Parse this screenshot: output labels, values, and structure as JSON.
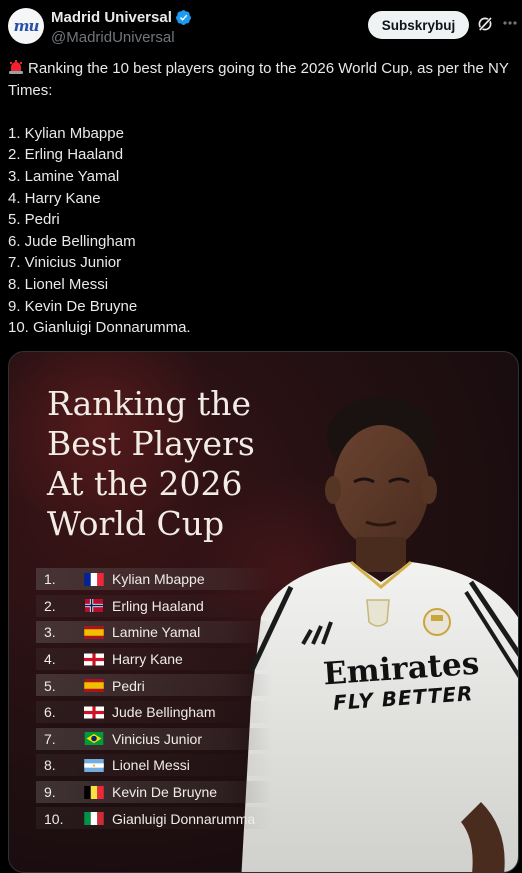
{
  "account": {
    "display_name": "Madrid Universal",
    "handle": "@MadridUniversal",
    "avatar_text": "mu"
  },
  "actions": {
    "subscribe_label": "Subskrybuj"
  },
  "tweet": {
    "text_intro": "Ranking the 10 best players going to the 2026 World Cup, as per the NY Times:",
    "list": [
      "1. Kylian Mbappe",
      "2. Erling Haaland",
      "3. Lamine Yamal",
      "4. Harry Kane",
      "5. Pedri",
      "6. Jude Bellingham",
      "7. Vinicius Junior",
      "8. Lionel Messi",
      "9. Kevin De Bruyne",
      "10. Gianluigi Donnarumma."
    ]
  },
  "image": {
    "headline": "Ranking the\nBest Players\nAt the 2026\nWorld Cup",
    "rankings": [
      {
        "rank": "1.",
        "flag": "france-flag",
        "name": "Kylian Mbappe"
      },
      {
        "rank": "2.",
        "flag": "norway-flag",
        "name": "Erling Haaland"
      },
      {
        "rank": "3.",
        "flag": "spain-flag",
        "name": "Lamine Yamal"
      },
      {
        "rank": "4.",
        "flag": "england-flag",
        "name": "Harry Kane"
      },
      {
        "rank": "5.",
        "flag": "spain-flag",
        "name": "Pedri"
      },
      {
        "rank": "6.",
        "flag": "england-flag",
        "name": "Jude Bellingham"
      },
      {
        "rank": "7.",
        "flag": "brazil-flag",
        "name": "Vinicius Junior"
      },
      {
        "rank": "8.",
        "flag": "argentina-flag",
        "name": "Lionel Messi"
      },
      {
        "rank": "9.",
        "flag": "belgium-flag",
        "name": "Kevin De Bruyne"
      },
      {
        "rank": "10.",
        "flag": "italy-flag",
        "name": "Gianluigi Donnarumma"
      }
    ],
    "shirt_text_1": "Emirates",
    "shirt_text_2": "FLY BETTER"
  },
  "colors": {
    "background": "#000000",
    "text": "#e7e9ea",
    "muted": "#71767b",
    "verified": "#1d9bf0",
    "alarm": "#f4212e"
  }
}
